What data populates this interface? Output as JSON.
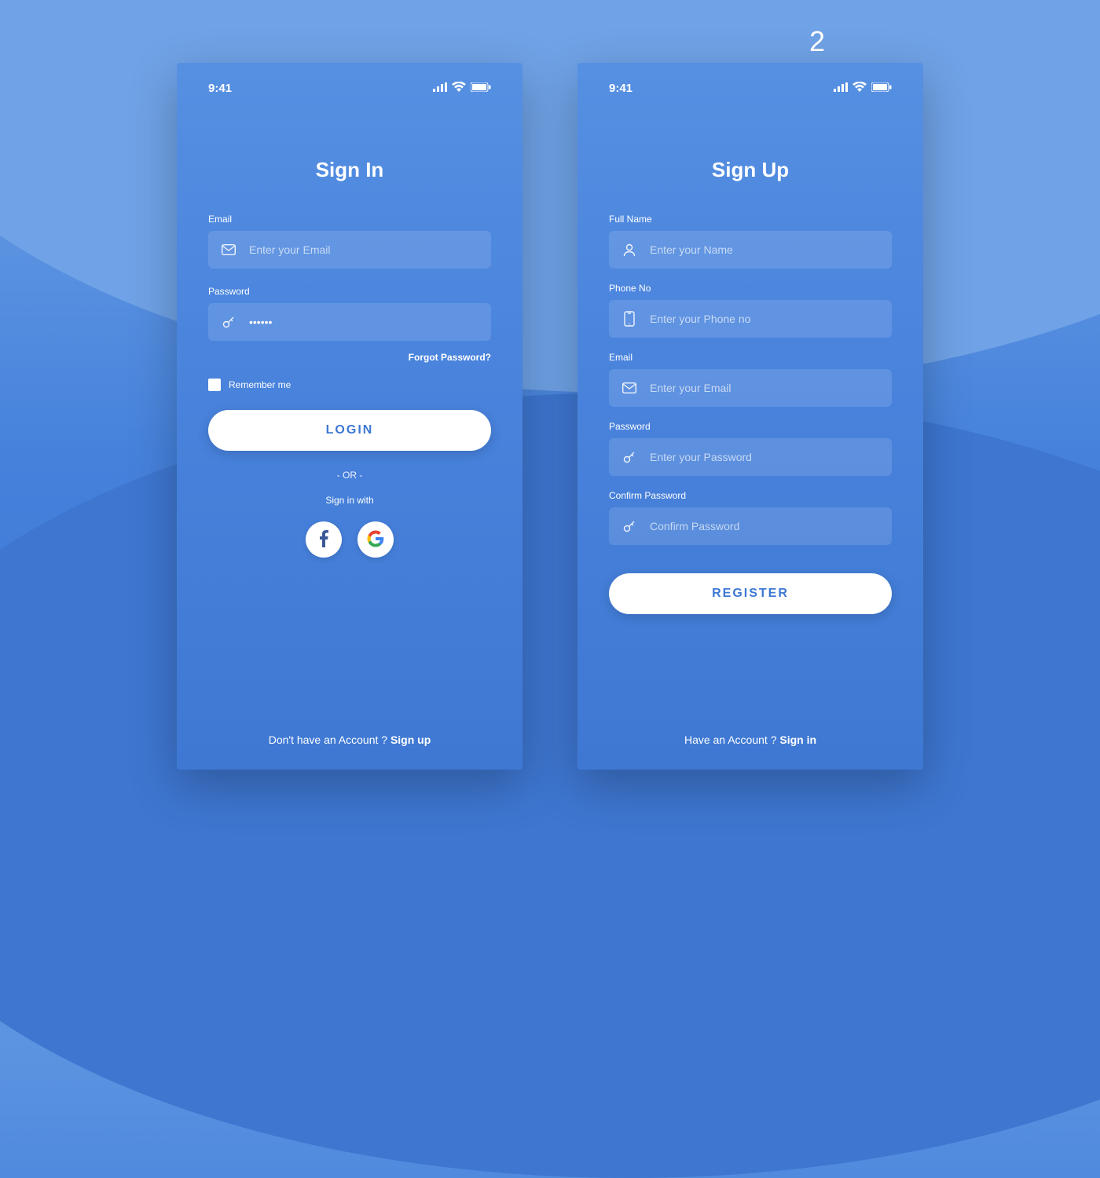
{
  "page_number": "2",
  "status": {
    "time": "9:41"
  },
  "signin": {
    "title": "Sign In",
    "email_label": "Email",
    "email_placeholder": "Enter your Email",
    "password_label": "Password",
    "password_value": "••••••",
    "forgot": "Forgot Password?",
    "remember": "Remember me",
    "login_btn": "LOGIN",
    "or": "- OR -",
    "sign_with": "Sign in with",
    "bottom_q": "Don't have an Account ? ",
    "bottom_action": "Sign up"
  },
  "signup": {
    "title": "Sign Up",
    "name_label": "Full Name",
    "name_placeholder": "Enter your Name",
    "phone_label": "Phone No",
    "phone_placeholder": "Enter your Phone no",
    "email_label": "Email",
    "email_placeholder": "Enter your Email",
    "password_label": "Password",
    "password_placeholder": "Enter your Password",
    "confirm_label": "Confirm Password",
    "confirm_placeholder": "Confirm Password",
    "register_btn": "REGISTER",
    "bottom_q": "Have an Account ? ",
    "bottom_action": "Sign in"
  }
}
